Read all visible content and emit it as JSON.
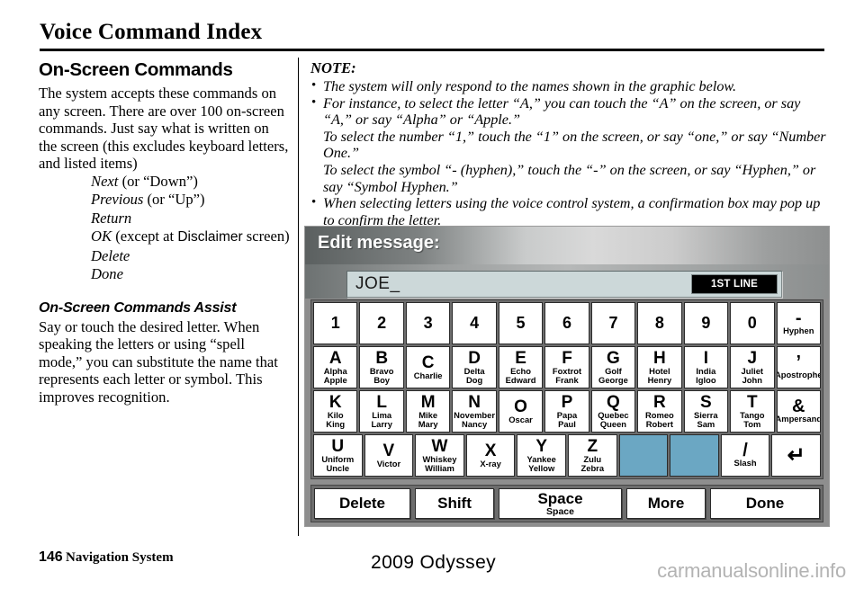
{
  "document": {
    "title": "Voice Command Index"
  },
  "left_column": {
    "section_heading": "On-Screen Commands",
    "intro_paragraph": "The system accepts these commands on any screen. There are over 100 on-screen commands. Just say what is written on the screen (this excludes keyboard letters, and listed items)",
    "commands": [
      {
        "name": "Next",
        "extra": " (or “Down”)",
        "sans_word": ""
      },
      {
        "name": "Previous",
        "extra": " (or “Up”)",
        "sans_word": ""
      },
      {
        "name": "Return",
        "extra": "",
        "sans_word": ""
      },
      {
        "name": "OK",
        "extra_before": " (except at ",
        "sans_word": "Disclaimer",
        "extra_after": " screen)"
      },
      {
        "name": "Delete",
        "extra": "",
        "sans_word": ""
      },
      {
        "name": "Done",
        "extra": "",
        "sans_word": ""
      }
    ],
    "assist_heading": "On-Screen Commands Assist",
    "assist_paragraph": "Say or touch the desired letter. When speaking the letters or using “spell mode,” you can substitute the name that represents each letter or symbol. This improves recognition."
  },
  "note": {
    "title": "NOTE:",
    "items": [
      {
        "text": "The system will only respond to the names shown in the graphic below.",
        "sub_lines": []
      },
      {
        "text": "For instance, to select the letter “A,” you can touch the “A” on the screen, or say “A,” or say “Alpha” or “Apple.”",
        "sub_lines": [
          "To select the number “1,” touch the “1” on the screen, or say “one,” or say “Number One.”",
          "To select the symbol “- (hyphen),” touch the “-” on the screen, or say “Hyphen,” or say “Symbol Hyphen.”"
        ]
      },
      {
        "text": "When selecting letters using the voice control system, a confirmation box may pop up to confirm the letter.",
        "sub_lines": []
      }
    ]
  },
  "nav_screen": {
    "header_title": "Edit message:",
    "input_value": "JOE_",
    "line_badge": "1ST LINE",
    "colors": {
      "disabled_key": "#6ba7c3",
      "input_background": "#ccd8d9",
      "keyboard_frame": "#6d6d6d",
      "screen_background": "#8e8e8e"
    },
    "keyboard_rows": [
      [
        {
          "main": "1",
          "sub": ""
        },
        {
          "main": "2",
          "sub": ""
        },
        {
          "main": "3",
          "sub": ""
        },
        {
          "main": "4",
          "sub": ""
        },
        {
          "main": "5",
          "sub": ""
        },
        {
          "main": "6",
          "sub": ""
        },
        {
          "main": "7",
          "sub": ""
        },
        {
          "main": "8",
          "sub": ""
        },
        {
          "main": "9",
          "sub": ""
        },
        {
          "main": "0",
          "sub": ""
        },
        {
          "main": "-",
          "sub": "Hyphen"
        }
      ],
      [
        {
          "main": "A",
          "sub": "Alpha\nApple"
        },
        {
          "main": "B",
          "sub": "Bravo\nBoy"
        },
        {
          "main": "C",
          "sub": "Charlie"
        },
        {
          "main": "D",
          "sub": "Delta\nDog"
        },
        {
          "main": "E",
          "sub": "Echo\nEdward"
        },
        {
          "main": "F",
          "sub": "Foxtrot\nFrank"
        },
        {
          "main": "G",
          "sub": "Golf\nGeorge"
        },
        {
          "main": "H",
          "sub": "Hotel\nHenry"
        },
        {
          "main": "I",
          "sub": "India\nIgloo"
        },
        {
          "main": "J",
          "sub": "Juliet\nJohn"
        },
        {
          "main": "’",
          "sub": "Apostrophe"
        }
      ],
      [
        {
          "main": "K",
          "sub": "Kilo\nKing"
        },
        {
          "main": "L",
          "sub": "Lima\nLarry"
        },
        {
          "main": "M",
          "sub": "Mike\nMary"
        },
        {
          "main": "N",
          "sub": "November\nNancy"
        },
        {
          "main": "O",
          "sub": "Oscar"
        },
        {
          "main": "P",
          "sub": "Papa\nPaul"
        },
        {
          "main": "Q",
          "sub": "Quebec\nQueen"
        },
        {
          "main": "R",
          "sub": "Romeo\nRobert"
        },
        {
          "main": "S",
          "sub": "Sierra\nSam"
        },
        {
          "main": "T",
          "sub": "Tango\nTom"
        },
        {
          "main": "&",
          "sub": "Ampersand"
        }
      ],
      [
        {
          "main": "U",
          "sub": "Uniform\nUncle"
        },
        {
          "main": "V",
          "sub": "Victor"
        },
        {
          "main": "W",
          "sub": "Whiskey\nWilliam"
        },
        {
          "main": "X",
          "sub": "X-ray"
        },
        {
          "main": "Y",
          "sub": "Yankee\nYellow"
        },
        {
          "main": "Z",
          "sub": "Zulu\nZebra"
        },
        {
          "main": "",
          "sub": "",
          "disabled": true
        },
        {
          "main": "",
          "sub": "",
          "disabled": true
        },
        {
          "main": "/",
          "sub": "Slash"
        },
        {
          "main": "↵",
          "sub": "",
          "enter": true
        }
      ]
    ],
    "action_buttons": [
      {
        "main": "Delete",
        "sub": ""
      },
      {
        "main": "Shift",
        "sub": ""
      },
      {
        "main": "Space",
        "sub": "Space"
      },
      {
        "main": "More",
        "sub": ""
      },
      {
        "main": "Done",
        "sub": ""
      }
    ]
  },
  "footer": {
    "page_number": "146",
    "section": "Navigation System",
    "model": "2009  Odyssey",
    "watermark": "carmanualsonline.info"
  }
}
